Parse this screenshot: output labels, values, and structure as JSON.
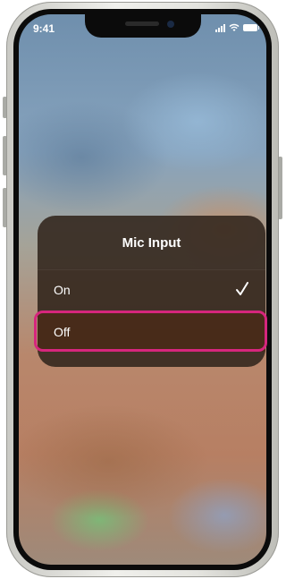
{
  "status_bar": {
    "time": "9:41",
    "icons": [
      "signal-icon",
      "wifi-icon",
      "battery-icon"
    ]
  },
  "menu": {
    "title": "Mic Input",
    "items": [
      {
        "label": "On",
        "selected": true
      },
      {
        "label": "Off",
        "selected": false
      }
    ]
  },
  "colors": {
    "highlight": "#d6267d",
    "menu_background": "#34281f",
    "text": "#ffffff"
  }
}
